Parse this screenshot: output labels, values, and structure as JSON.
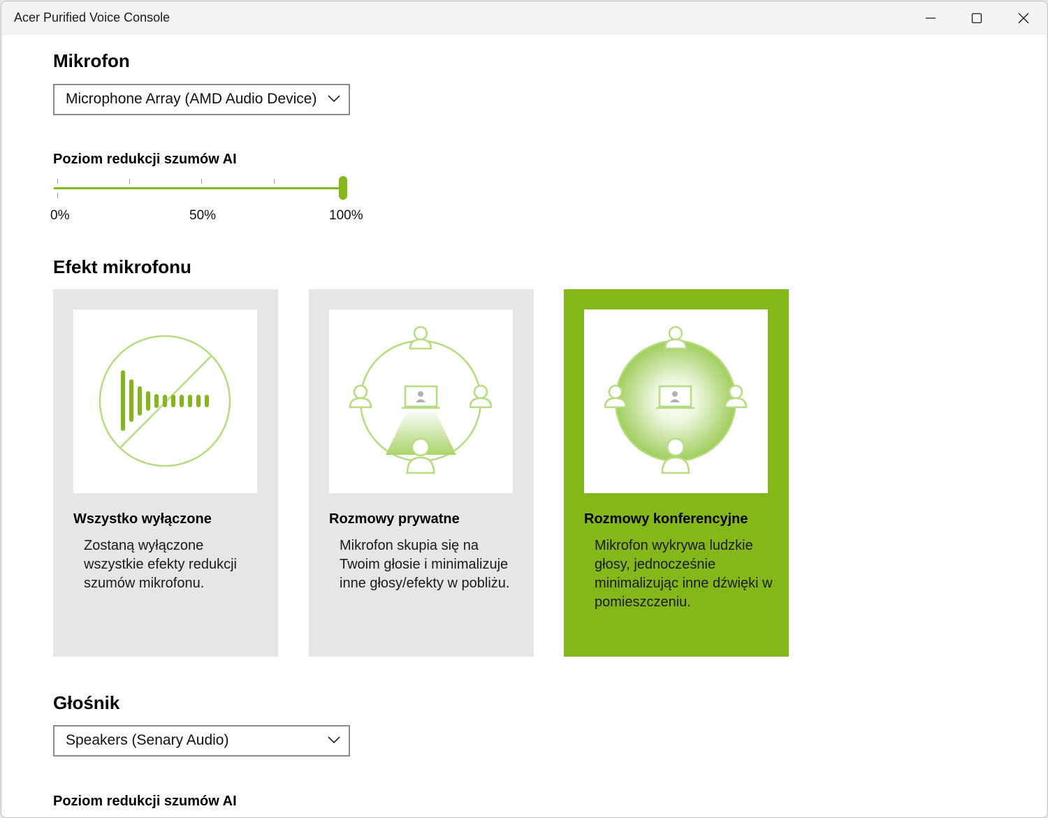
{
  "window": {
    "title": "Acer Purified Voice Console"
  },
  "microphone": {
    "heading": "Mikrofon",
    "device": "Microphone Array (AMD Audio Device)",
    "noise_label": "Poziom redukcji szumów AI",
    "noise_level_percent": 100,
    "tick_labels": [
      "0%",
      "50%",
      "100%"
    ]
  },
  "effects": {
    "heading": "Efekt mikrofonu",
    "selected": "Rozmowy konferencyjne",
    "cards": [
      {
        "title": "Wszystko wyłączone",
        "description": "Zostaną wyłączone wszystkie efekty redukcji szumów mikrofonu.",
        "icon": "noise-off-icon"
      },
      {
        "title": "Rozmowy prywatne",
        "description": "Mikrofon skupia się na Twoim głosie i minimalizuje inne głosy/efekty w pobliżu.",
        "icon": "private-call-icon"
      },
      {
        "title": "Rozmowy konferencyjne",
        "description": "Mikrofon wykrywa ludzkie głosy, jednocześnie minimalizując inne dźwięki w pomieszczeniu.",
        "icon": "conference-call-icon"
      }
    ]
  },
  "speaker": {
    "heading": "Głośnik",
    "device": "Speakers (Senary Audio)",
    "noise_label": "Poziom redukcji szumów AI"
  },
  "colors": {
    "accent": "#84b81a",
    "card_bg": "#e6e6e6",
    "icon_stroke": "#b5dc7e"
  }
}
